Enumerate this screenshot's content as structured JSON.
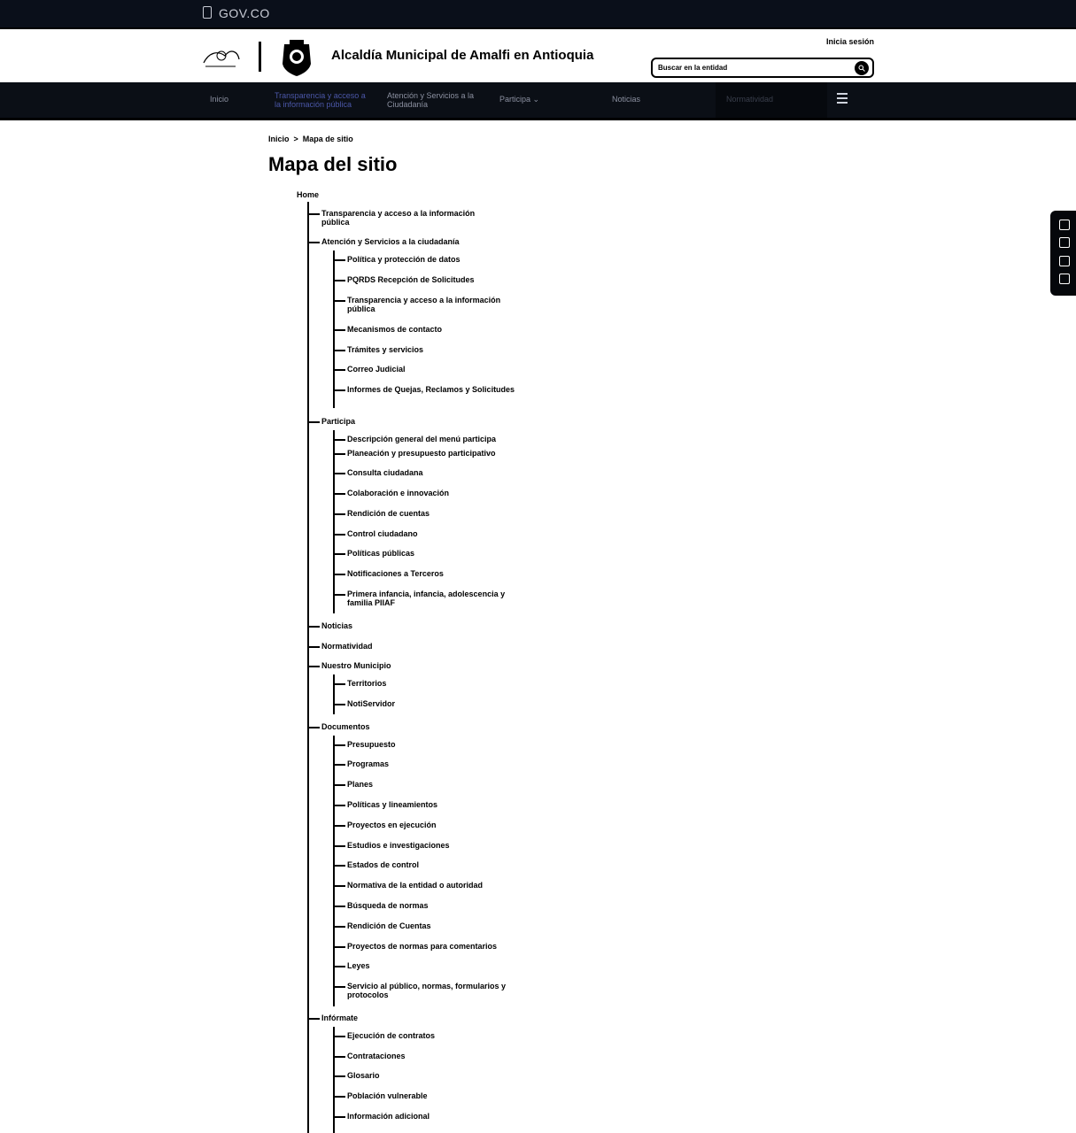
{
  "topbar": {
    "brand": "GOV.CO"
  },
  "header": {
    "title": "Alcaldía Municipal de Amalfi en Antioquia",
    "login": "Inicia sesión",
    "search_placeholder": "Buscar en la entidad"
  },
  "nav": {
    "items": [
      {
        "label": "Inicio"
      },
      {
        "label": "Transparencia y acceso a la información pública"
      },
      {
        "label": "Atención y Servicios a la Ciudadanía"
      },
      {
        "label": "Participa"
      },
      {
        "label": "Noticias"
      },
      {
        "label": "Normatividad"
      }
    ]
  },
  "breadcrumb": {
    "home": "Inicio",
    "separator": ">",
    "current": "Mapa de sitio"
  },
  "page": {
    "title": "Mapa del sitio"
  },
  "sitemap": {
    "root": "Home",
    "level1": [
      "Transparencia y acceso a la información pública",
      "Atención y Servicios a la ciudadanía",
      "Participa",
      "Noticias",
      "Normatividad",
      "Nuestro Municipio",
      "Documentos",
      "Infórmate"
    ],
    "atencion": [
      "Política y protección de datos",
      "PQRDS Recepción de Solicitudes",
      "Transparencia y acceso a la información pública",
      "Mecanismos de contacto",
      "Trámites y servicios",
      "Correo Judicial",
      "Informes de Quejas, Reclamos y Solicitudes"
    ],
    "participa": [
      "Descripción general del menú participa",
      "Planeación y presupuesto participativo",
      "Consulta ciudadana",
      "Colaboración e innovación",
      "Rendición de cuentas",
      "Control ciudadano",
      "Políticas públicas",
      "Notificaciones a Terceros",
      "Primera infancia, infancia, adolescencia y familia PIIAF"
    ],
    "municipio": [
      "Territorios",
      "NotiServidor"
    ],
    "documentos": [
      "Presupuesto",
      "Programas",
      "Planes",
      "Políticas y lineamientos",
      "Proyectos en ejecución",
      "Estudios e investigaciones",
      "Estados de control",
      "Normativa de la entidad o autoridad",
      "Búsqueda de normas",
      "Rendición de Cuentas",
      "Proyectos de normas para comentarios",
      "Leyes",
      "Servicio al público, normas, formularios y protocolos"
    ],
    "informate": [
      "Ejecución de contratos",
      "Contrataciones",
      "Glosario",
      "Población vulnerable",
      "Información adicional"
    ]
  }
}
